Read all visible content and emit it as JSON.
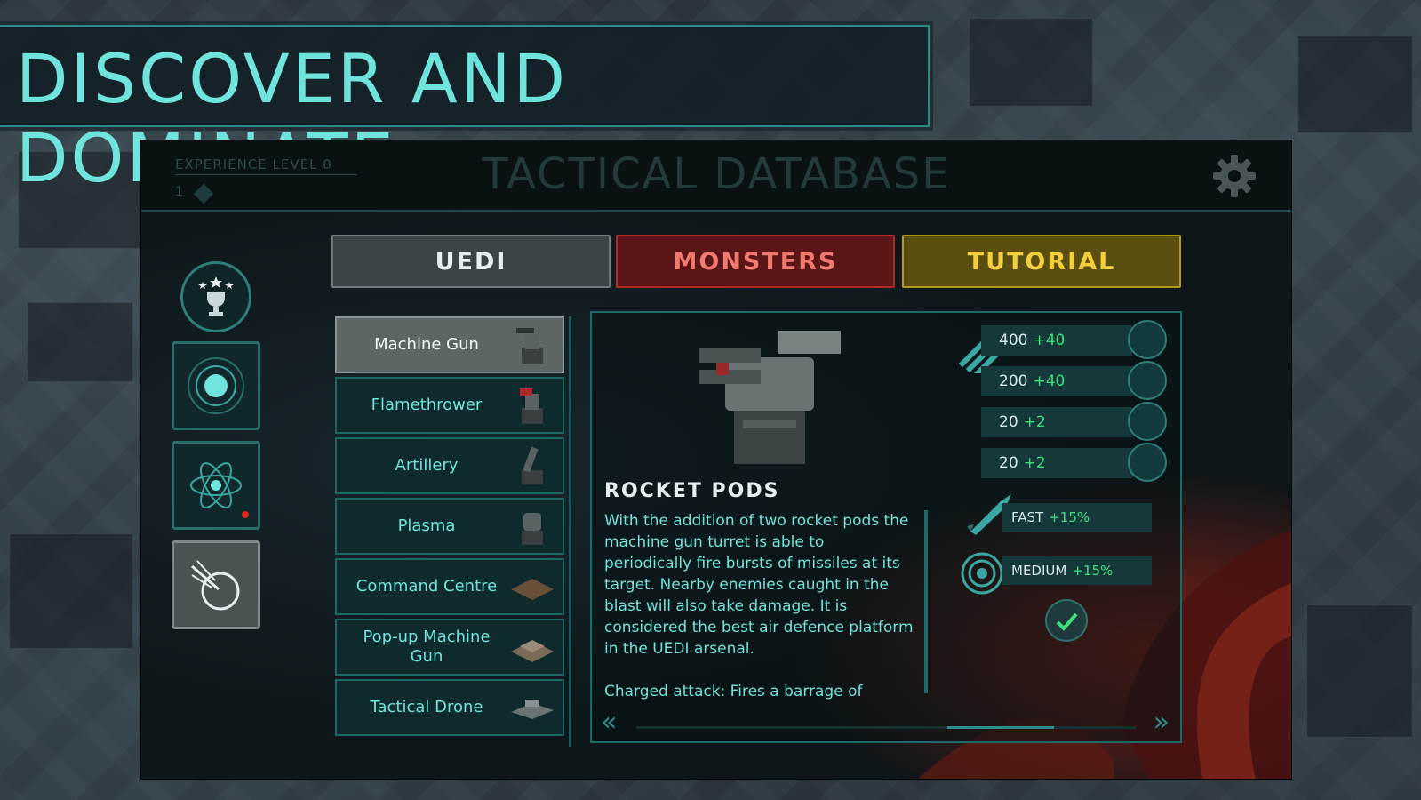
{
  "banner": {
    "title": "DISCOVER AND DOMINATE"
  },
  "header": {
    "experience_label": "EXPERIENCE LEVEL 0",
    "experience_value": "1",
    "title": "TACTICAL DATABASE",
    "settings_icon": "gear-icon"
  },
  "sidebar": {
    "items": [
      {
        "name": "trophy",
        "icon": "trophy-icon"
      },
      {
        "name": "planet",
        "icon": "planet-icon"
      },
      {
        "name": "research",
        "icon": "atom-icon",
        "notification": true
      },
      {
        "name": "database",
        "icon": "radar-icon",
        "active": true
      }
    ]
  },
  "tabs": [
    {
      "label": "UEDI",
      "color": "#e6eef0",
      "active": true
    },
    {
      "label": "MONSTERS",
      "color": "#f07a70"
    },
    {
      "label": "TUTORIAL",
      "color": "#f4cf3c"
    }
  ],
  "units": [
    {
      "label": "Machine Gun",
      "selected": true
    },
    {
      "label": "Flamethrower"
    },
    {
      "label": "Artillery"
    },
    {
      "label": "Plasma"
    },
    {
      "label": "Command Centre"
    },
    {
      "label": "Pop-up Machine Gun"
    },
    {
      "label": "Tactical Drone"
    }
  ],
  "detail": {
    "name": "ROCKET PODS",
    "description": "With the addition of two rocket pods the machine gun turret is able to periodically fire bursts of missiles at its target. Nearby enemies caught in the blast will also take damage. It is considered the best air defence platform in the UEDI arsenal.",
    "charged_attack": "Charged attack: Fires a barrage of",
    "stats": [
      {
        "value": "400",
        "bonus": "+40"
      },
      {
        "value": "200",
        "bonus": "+40"
      },
      {
        "value": "20",
        "bonus": "+2"
      },
      {
        "value": "20",
        "bonus": "+2"
      }
    ],
    "fire_rate": {
      "label": "FAST",
      "bonus": "+15%"
    },
    "range": {
      "label": "MEDIUM",
      "bonus": "+15%"
    },
    "nav_prev": "«",
    "nav_next": "»"
  },
  "colors": {
    "accent": "#6fe4dc",
    "bonus": "#3ee07a",
    "monsters": "#b12a28",
    "tutorial": "#b19a1c"
  }
}
